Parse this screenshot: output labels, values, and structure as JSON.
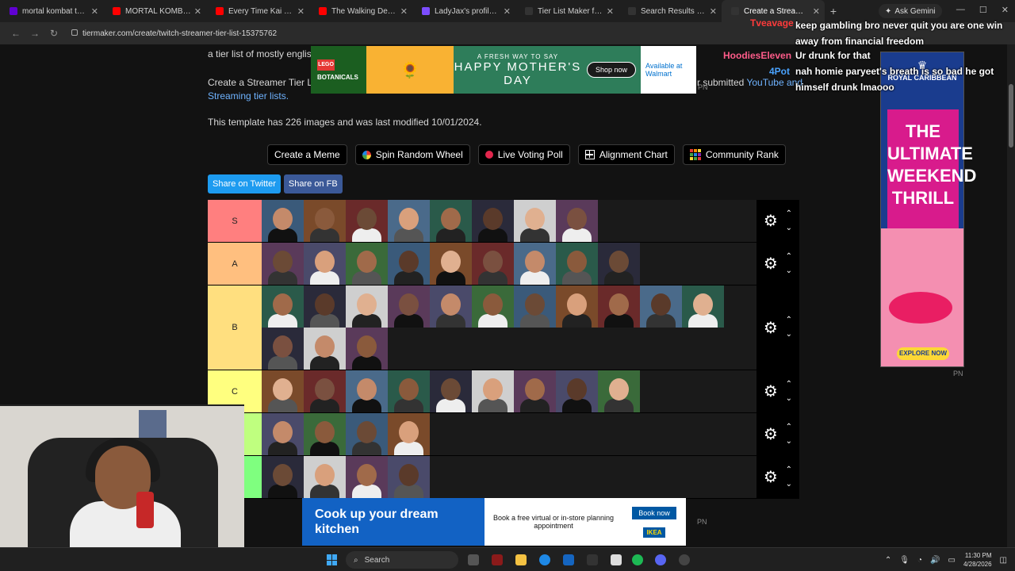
{
  "browser": {
    "tabs": [
      {
        "title": "mortal kombat the arr",
        "favicon_color": "#6001d2"
      },
      {
        "title": "MORTAL KOMBAT DEC",
        "favicon_color": "#ff0000"
      },
      {
        "title": "Every Time Kai Cenat R",
        "favicon_color": "#ff0000"
      },
      {
        "title": "The Walking Dead: Epi",
        "favicon_color": "#ff0000"
      },
      {
        "title": "LadyJax's profile - E-Pal",
        "favicon_color": "#7c4dff"
      },
      {
        "title": "Tier List Maker for Eve",
        "favicon_color": "#333333"
      },
      {
        "title": "Search Results for 'stre",
        "favicon_color": "#333333"
      },
      {
        "title": "Create a Streamer Tier",
        "favicon_color": "#333333",
        "active": true
      }
    ],
    "new_tab": "+",
    "ask_gemini": "Ask Gemini",
    "url": "tiermaker.com/create/twitch-streamer-tier-list-15375762"
  },
  "page": {
    "intro_1": "a tier list of mostly english",
    "intro_2": "Create a Streamer Tier Lis",
    "intro_2_link": "Streaming tier lists.",
    "intro_3": "r submitted",
    "intro_3_link": "YouTube and",
    "template_info": "This template has 226 images and was last modified 10/01/2024.",
    "actions": [
      {
        "label": "Create a Meme",
        "icon": "none"
      },
      {
        "label": "Spin Random Wheel",
        "icon": "wheel-icon"
      },
      {
        "label": "Live Voting Poll",
        "icon": "live-dot-icon"
      },
      {
        "label": "Alignment Chart",
        "icon": "grid-icon"
      },
      {
        "label": "Community Rank",
        "icon": "rank-icon"
      }
    ],
    "share": [
      {
        "label": "Share on Twitter"
      },
      {
        "label": "Share on FB"
      }
    ]
  },
  "tiers": [
    {
      "label": "S",
      "color": "#ff7f7f",
      "count": 8
    },
    {
      "label": "A",
      "color": "#ffbf7f",
      "count": 9
    },
    {
      "label": "B",
      "color": "#ffdf7f",
      "count": 14
    },
    {
      "label": "C",
      "color": "#ffff7f",
      "count": 9
    },
    {
      "label": "",
      "color": "#bfff7f",
      "count": 4
    },
    {
      "label": "",
      "color": "#7fff7f",
      "count": 4
    }
  ],
  "tier_controls": {
    "gear": "⚙",
    "up": "⌃",
    "down": "⌄"
  },
  "chat": [
    {
      "name": "Tveavage",
      "name_color": "#ff3b3b",
      "message": "keep gambling bro never quit you are one win away from financial freedom"
    },
    {
      "name": "HoodiesEleven",
      "name_color": "#ff5c8a",
      "message": "Ur drunk for that"
    },
    {
      "name": "4Pot",
      "name_color": "#4aa3ff",
      "message": "nah homie paryeet's breath is so bad he got himself drunk lmaooo"
    }
  ],
  "ads": {
    "top": {
      "brand": "LEGO",
      "brand_sub": "BOTANICALS",
      "tag": "A FRESH WAY TO SAY",
      "headline": "HAPPY MOTHER'S DAY",
      "cta": "Shop now",
      "retailer": "Available at Walmart"
    },
    "side": {
      "brand": "ROYAL CARIBBEAN",
      "headline": "THE ULTIMATE WEEKEND THRILL",
      "cta": "EXPLORE NOW"
    },
    "bottom": {
      "headline": "Cook up your dream kitchen",
      "body": "Book a free virtual or in-store planning appointment",
      "cta": "Book now",
      "brand": "IKEA"
    },
    "pn": "PN"
  },
  "taskbar": {
    "search": "Search",
    "time": "11:30 PM",
    "date": "4/28/2026"
  }
}
